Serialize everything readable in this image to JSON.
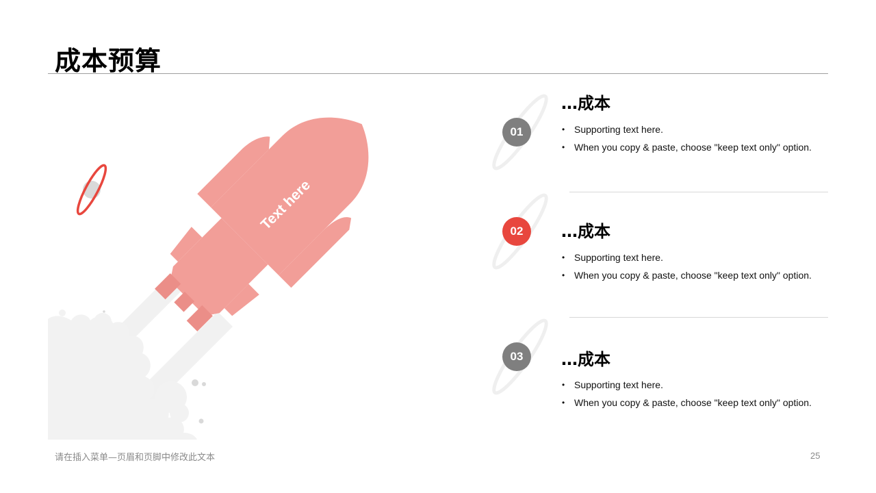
{
  "slide": {
    "title": "成本预算",
    "footer_text": "请在插入菜单—页眉和页脚中修改此文本",
    "page_number": "25"
  },
  "illustration": {
    "rocket_label": "Text here",
    "rocket_color": "#f29e98",
    "planet_ring_color": "#e8473e",
    "smoke_color": "#f2f2f2"
  },
  "items": [
    {
      "number": "01",
      "badge_color": "#7f7f7f",
      "title": "…成本",
      "bullets": [
        "Supporting text here.",
        "When you copy & paste, choose \"keep text only\" option."
      ]
    },
    {
      "number": "02",
      "badge_color": "#e8473e",
      "title": "…成本",
      "bullets": [
        "Supporting text here.",
        "When you copy & paste, choose \"keep text only\" option."
      ]
    },
    {
      "number": "03",
      "badge_color": "#7f7f7f",
      "title": "…成本",
      "bullets": [
        "Supporting text here.",
        "When you copy & paste, choose \"keep text only\" option."
      ]
    }
  ]
}
